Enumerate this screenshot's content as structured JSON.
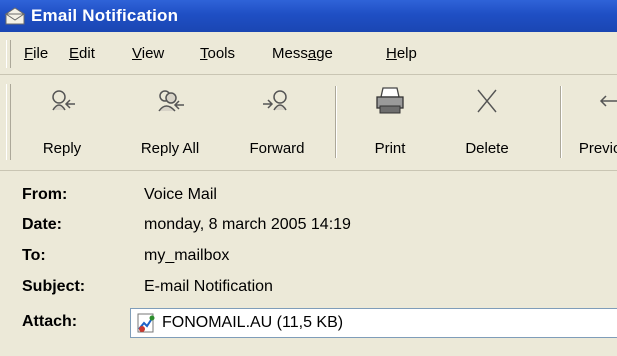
{
  "window": {
    "title": "Email Notification",
    "icon": "envelope-icon"
  },
  "menubar": {
    "items": [
      {
        "label": "File",
        "accel": "F",
        "rest": "ile"
      },
      {
        "label": "Edit",
        "accel": "E",
        "rest": "dit"
      },
      {
        "label": "View",
        "accel": "V",
        "rest": "iew"
      },
      {
        "label": "Tools",
        "accel": "T",
        "rest": "ools"
      },
      {
        "label": "Message",
        "pre": "Mess",
        "accel": "a",
        "rest": "ge"
      },
      {
        "label": "Help",
        "accel": "H",
        "rest": "elp"
      }
    ]
  },
  "toolbar": {
    "buttons": [
      {
        "label": "Reply",
        "icon": "reply-icon"
      },
      {
        "label": "Reply All",
        "icon": "reply-all-icon"
      },
      {
        "label": "Forward",
        "icon": "forward-icon"
      },
      {
        "label": "Print",
        "icon": "printer-icon"
      },
      {
        "label": "Delete",
        "icon": "delete-icon"
      },
      {
        "label": "Previous",
        "icon": "previous-icon"
      }
    ]
  },
  "headers": {
    "from": {
      "label": "From:",
      "value": "Voice Mail"
    },
    "date": {
      "label": "Date:",
      "value": "monday, 8 march 2005 14:19"
    },
    "to": {
      "label": "To:",
      "value": "my_mailbox"
    },
    "subject": {
      "label": "Subject:",
      "value": "E-mail Notification"
    },
    "attach": {
      "label": "Attach:",
      "value": "FONOMAIL.AU (11,5 KB)",
      "icon": "audio-file-icon"
    }
  },
  "colors": {
    "titlebar": "#1f4fc4",
    "window_bg": "#ece9d8"
  }
}
